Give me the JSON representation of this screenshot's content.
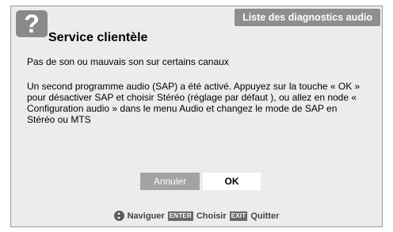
{
  "dialog": {
    "tab_label": "Liste des diagnostics audio",
    "icon_glyph": "?",
    "title": "Service clientèle",
    "issue": "Pas de son ou mauvais son sur certains canaux",
    "message": "Un second programme audio  (SAP) a été activé. Appuyez sur la touche « OK » pour désactiver SAP et choisir Stéréo (réglage par défaut ), ou allez en node « Configuration audio  » dans le menu Audio et changez le mode de SAP en Stéréo ou MTS"
  },
  "buttons": {
    "cancel_label": "Annuler",
    "ok_label": "OK"
  },
  "footer": {
    "nav_label": "Naviguer",
    "enter_key": "ENTER",
    "choose_label": "Choisir",
    "exit_key": "EXIT",
    "quit_label": "Quitter"
  },
  "icons": {
    "help": "question-mark-icon",
    "navigate": "navigation-arrows-icon"
  }
}
